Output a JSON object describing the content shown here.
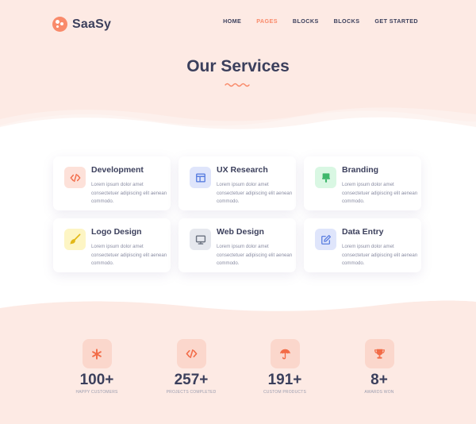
{
  "brand": {
    "name": "SaaSy"
  },
  "nav": {
    "items": [
      {
        "label": "HOME",
        "active": false
      },
      {
        "label": "PAGES",
        "active": true
      },
      {
        "label": "BLOCKS",
        "active": false
      },
      {
        "label": "BLOCKS",
        "active": false
      },
      {
        "label": "GET STARTED",
        "active": false
      }
    ]
  },
  "hero": {
    "title": "Our Services"
  },
  "services": [
    {
      "title": "Development",
      "desc": "Lorem ipsum dolor amet consectetuer adipiscing elit aenean commodo.",
      "icon": "code-icon",
      "icon_color": "#f26b47",
      "icon_bg": "#fde1d9"
    },
    {
      "title": "UX Research",
      "desc": "Lorem ipsum dolor amet consectetuer adipiscing elit aenean commodo.",
      "icon": "layout-icon",
      "icon_color": "#5b7fe0",
      "icon_bg": "#dfe5fb"
    },
    {
      "title": "Branding",
      "desc": "Lorem ipsum dolor amet consectetuer adipiscing elit aenean commodo.",
      "icon": "brush-stamp-icon",
      "icon_color": "#3fb86c",
      "icon_bg": "#d9f7e3"
    },
    {
      "title": "Logo Design",
      "desc": "Lorem ipsum dolor amet consectetuer adipiscing elit aenean commodo.",
      "icon": "paint-brush-icon",
      "icon_color": "#e2b818",
      "icon_bg": "#fdf5c4"
    },
    {
      "title": "Web Design",
      "desc": "Lorem ipsum dolor amet consectetuer adipiscing elit aenean commodo.",
      "icon": "monitor-icon",
      "icon_color": "#6b7280",
      "icon_bg": "#e6e8ee"
    },
    {
      "title": "Data Entry",
      "desc": "Lorem ipsum dolor amet consectetuer adipiscing elit aenean commodo.",
      "icon": "edit-icon",
      "icon_color": "#5b7fe0",
      "icon_bg": "#dfe5fb"
    }
  ],
  "stats": [
    {
      "value": "100+",
      "label": "HAPPY CUSTOMERS",
      "icon": "asterisk-icon"
    },
    {
      "value": "257+",
      "label": "PROJECTS COMPLETED",
      "icon": "code-icon"
    },
    {
      "value": "191+",
      "label": "CUSTOM PRODUCTS",
      "icon": "umbrella-icon"
    },
    {
      "value": "8+",
      "label": "AWARDS WON",
      "icon": "trophy-icon"
    }
  ],
  "colors": {
    "accent": "#f98a6a",
    "hero_bg": "#fdeae4",
    "text": "#3b3f5c",
    "muted": "#8a8da3"
  }
}
